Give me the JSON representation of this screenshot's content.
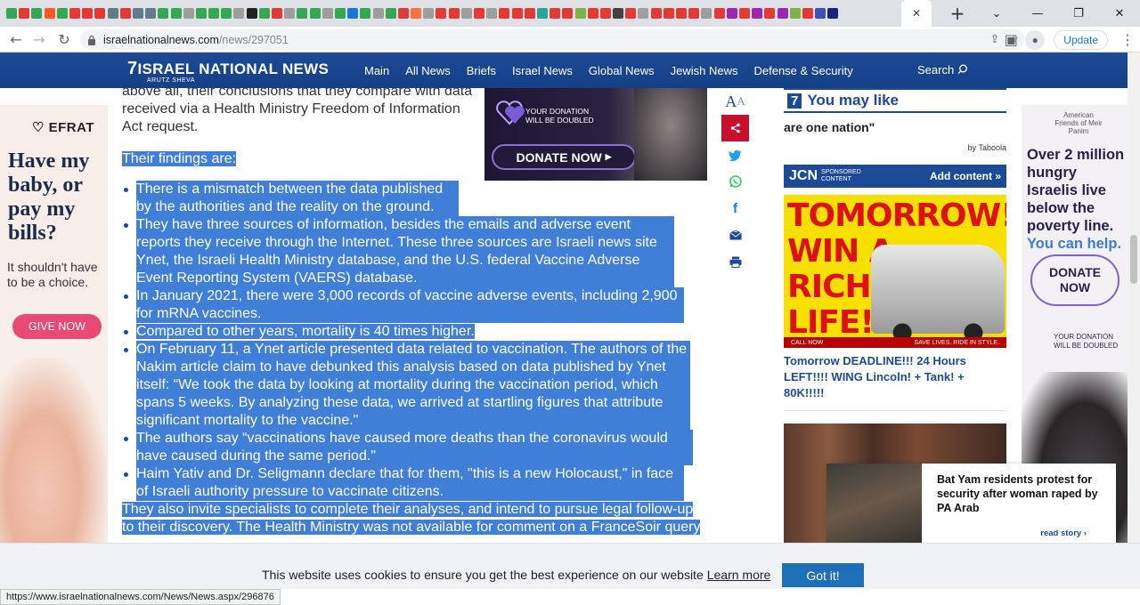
{
  "browser": {
    "tab_favicons": [
      "#34a853",
      "#e53935",
      "#34a853",
      "#ff5722",
      "#34a853",
      "#e53935",
      "#e53935",
      "#e53935",
      "#607d8b",
      "#e53935",
      "#607d8b",
      "#607d8b",
      "#34a853",
      "#34a853",
      "#9e9e9e",
      "#34a853",
      "#34a853",
      "#34a853",
      "#9e9e9e",
      "#212121",
      "#34a853",
      "#e53935",
      "#9e9e9e",
      "#34a853",
      "#34a853",
      "#9e9e9e",
      "#34a853",
      "#1976d2",
      "#34a853",
      "#9e9e9e",
      "#34a853",
      "#e53935",
      "#ff7043",
      "#9e9e9e",
      "#e53935",
      "#e53935",
      "#9e9e9e",
      "#e53935",
      "#9e9e9e",
      "#e53935",
      "#e53935",
      "#e53935",
      "#26a69a",
      "#e53935",
      "#e53935",
      "#7cb342",
      "#e53935",
      "#e53935",
      "#424242",
      "#e53935",
      "#9e9e9e",
      "#e53935",
      "#e53935",
      "#e53935",
      "#e53935",
      "#9e9e9e",
      "#e53935",
      "#9c27b0",
      "#e53935",
      "#9c27b0",
      "#e53935",
      "#9c27b0",
      "#7cb342",
      "#e53935",
      "#3f51b5",
      "#1a237e"
    ],
    "active_tab_close": "✕",
    "new_tab": "+",
    "url_host": "israelnationalnews.com",
    "url_path": "/news/297051",
    "update_label": "Update",
    "status_url": "https://www.israelnationalnews.com/News/News.aspx/296876"
  },
  "nav": {
    "logo": "ISRAEL NATIONAL NEWS",
    "logo_sub": "ARUTZ SHEVA",
    "items": [
      "Main",
      "All News",
      "Briefs",
      "Israel News",
      "Global News",
      "Jewish News",
      "Defense & Security"
    ],
    "search": "Search"
  },
  "left_ad": {
    "brand": "EFRAT",
    "headline": "Have my baby, or pay my bills?",
    "sub": "It shouldn't have to be a choice.",
    "button": "GIVE NOW"
  },
  "article": {
    "top_line1": "above all, their conclusions that they compare with data",
    "top_line2": "received via a Health Ministry Freedom of Information",
    "top_line3": "Act request.",
    "findings": "Their findings are:",
    "bullets": [
      "There is a mismatch between the data published by the authorities and the reality on the ground.",
      "They have three sources of information, besides the emails and adverse event reports they receive through the Internet. These three sources are Israeli news site Ynet, the Israeli Health Ministry database, and the U.S. federal Vaccine Adverse Event Reporting System (VAERS) database.",
      "In January 2021, there were 3,000 records of vaccine adverse events, including 2,900 for mRNA vaccines.",
      "Compared to other years, mortality is 40 times higher.",
      "On February 11, a Ynet article presented data related to vaccination. The authors of the Nakim article claim to have debunked this analysis based on data published by Ynet itself: “We took the data by looking at mortality during the vaccination period, which spans 5 weeks. By analyzing these data, we arrived at startling figures that attribute significant mortality to the vaccine.\"",
      "The authors say “vaccinations have caused more deaths than the coronavirus would have caused during the same period.\"",
      "Haim Yativ and Dr. Seligmann declare that for them, \"this is a new Holocaust,\" in face of Israeli authority pressure to vaccinate citizens."
    ],
    "bottom": "They also invite specialists to complete their analyses, and intend to pursue legal follow-up to their discovery. The Health Ministry was not available for comment on a FranceSoir query"
  },
  "donation_ad": {
    "small": "YOUR DONATION WILL BE DOUBLED",
    "button": "DONATE NOW"
  },
  "share": {
    "text_size": "A",
    "text_size_small": "A",
    "icons": [
      "share-icon",
      "twitter-icon",
      "whatsapp-icon",
      "facebook-icon",
      "email-icon",
      "print-icon"
    ]
  },
  "right_col": {
    "you_may_like": "You may like",
    "nation": "are one nation\"",
    "taboola": "by Taboola",
    "jcn_logo": "JCN",
    "jcn_sponsored": "SPONSORED CONTENT",
    "jcn_add": "Add content",
    "tomorrow_title": "TOMORROW! WIN A RICH LIFE!",
    "tomorrow_footer_left": "CALL NOW",
    "tomorrow_footer_right": "SAVE LIVES. RIDE IN STYLE.",
    "tomorrow_link": "Tomorrow DEADLINE!!! 24 Hours LEFT!!!! WING Lincoln! + Tank! + 80K!!!!!"
  },
  "right_ad": {
    "brand": "American Friends of Meir Panim",
    "headline": "Over 2 million hungry Israelis live below the poverty line.",
    "headline_blue": "You can help.",
    "button": "DONATE NOW",
    "heart_text": "YOUR DONATION WILL BE DOUBLED"
  },
  "popup": {
    "title": "Bat Yam residents protest for security after woman raped by PA Arab",
    "read": "read story ›"
  },
  "cookie": {
    "text": "This website uses cookies to ensure you get the best experience on our website",
    "link": "Learn more",
    "button": "Got it!"
  }
}
